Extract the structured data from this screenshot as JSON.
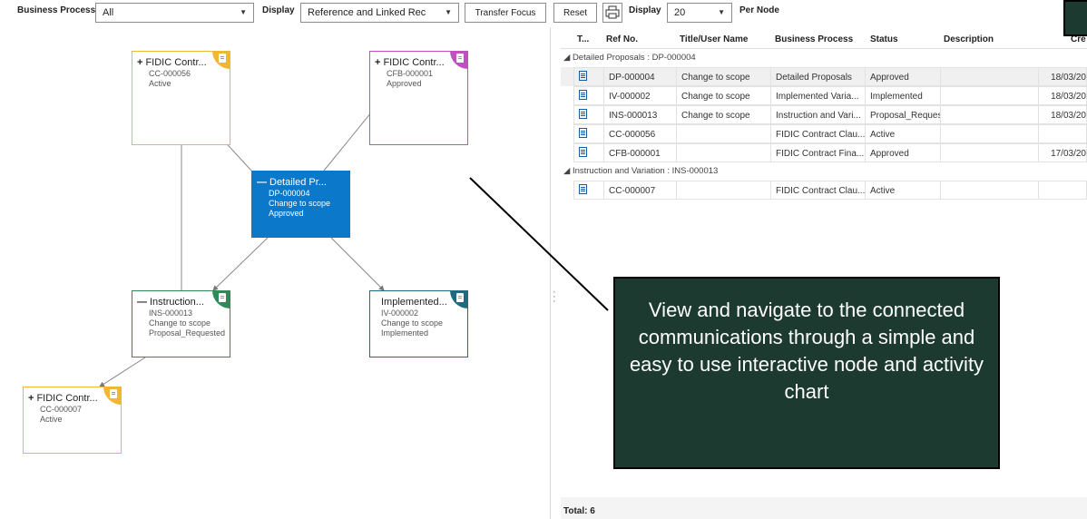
{
  "toolbar": {
    "business_process_label": "Business Process",
    "business_process_value": "All",
    "display_label": "Display",
    "display_value": "Reference and Linked Rec",
    "transfer_focus_label": "Transfer Focus",
    "reset_label": "Reset",
    "display2_label": "Display",
    "per_node_value": "20",
    "per_node_label": "Per Node"
  },
  "nodes": [
    {
      "id": "cc56",
      "symbol": "+",
      "title": "FIDIC Contr...",
      "lines": [
        "CC-000056",
        "Active"
      ],
      "color": "#f2b534"
    },
    {
      "id": "cfb1",
      "symbol": "+",
      "title": "FIDIC Contr...",
      "lines": [
        "CFB-000001",
        "Approved"
      ],
      "color": "#c050c0"
    },
    {
      "id": "dp4",
      "symbol": "—",
      "title": "Detailed Pr...",
      "lines": [
        "DP-000004",
        "Change to scope",
        "Approved"
      ],
      "color": "#0b78c9",
      "selected": true
    },
    {
      "id": "ins13",
      "symbol": "—",
      "title": "Instruction...",
      "lines": [
        "INS-000013",
        "Change to scope",
        "Proposal_Requested"
      ],
      "color": "#2e8b57"
    },
    {
      "id": "iv2",
      "symbol": "",
      "title": "Implemented...",
      "lines": [
        "IV-000002",
        "Change to scope",
        "Implemented"
      ],
      "color": "#1e6b80"
    },
    {
      "id": "cc7",
      "symbol": "+",
      "title": "FIDIC Contr...",
      "lines": [
        "CC-000007",
        "Active"
      ],
      "color": "#f2b534"
    }
  ],
  "grid": {
    "columns": [
      "T...",
      "Ref No.",
      "Title/User Name",
      "Business Process",
      "Status",
      "Description",
      "Cre"
    ],
    "groups": [
      {
        "label": "◢ Detailed Proposals : DP-000004",
        "rows": [
          {
            "ref": "DP-000004",
            "title": "Change to scope",
            "process": "Detailed Proposals",
            "status": "Approved",
            "description": "",
            "created": "18/03/20"
          },
          {
            "ref": "IV-000002",
            "title": "Change to scope",
            "process": "Implemented Varia...",
            "status": "Implemented",
            "description": "",
            "created": "18/03/20"
          },
          {
            "ref": "INS-000013",
            "title": "Change to scope",
            "process": "Instruction and Vari...",
            "status": "Proposal_Reques",
            "description": "",
            "created": "18/03/20"
          },
          {
            "ref": "CC-000056",
            "title": "",
            "process": "FIDIC Contract Clau...",
            "status": "Active",
            "description": "",
            "created": ""
          },
          {
            "ref": "CFB-000001",
            "title": "",
            "process": "FIDIC Contract Fina...",
            "status": "Approved",
            "description": "",
            "created": "17/03/20"
          }
        ]
      },
      {
        "label": "◢ Instruction and Variation : INS-000013",
        "rows": [
          {
            "ref": "CC-000007",
            "title": "",
            "process": "FIDIC Contract Clau...",
            "status": "Active",
            "description": "",
            "created": ""
          }
        ]
      }
    ],
    "footer": "Total: 6"
  },
  "callout_text": "View and navigate to the connected communications through a simple and easy to use interactive node and activity chart"
}
